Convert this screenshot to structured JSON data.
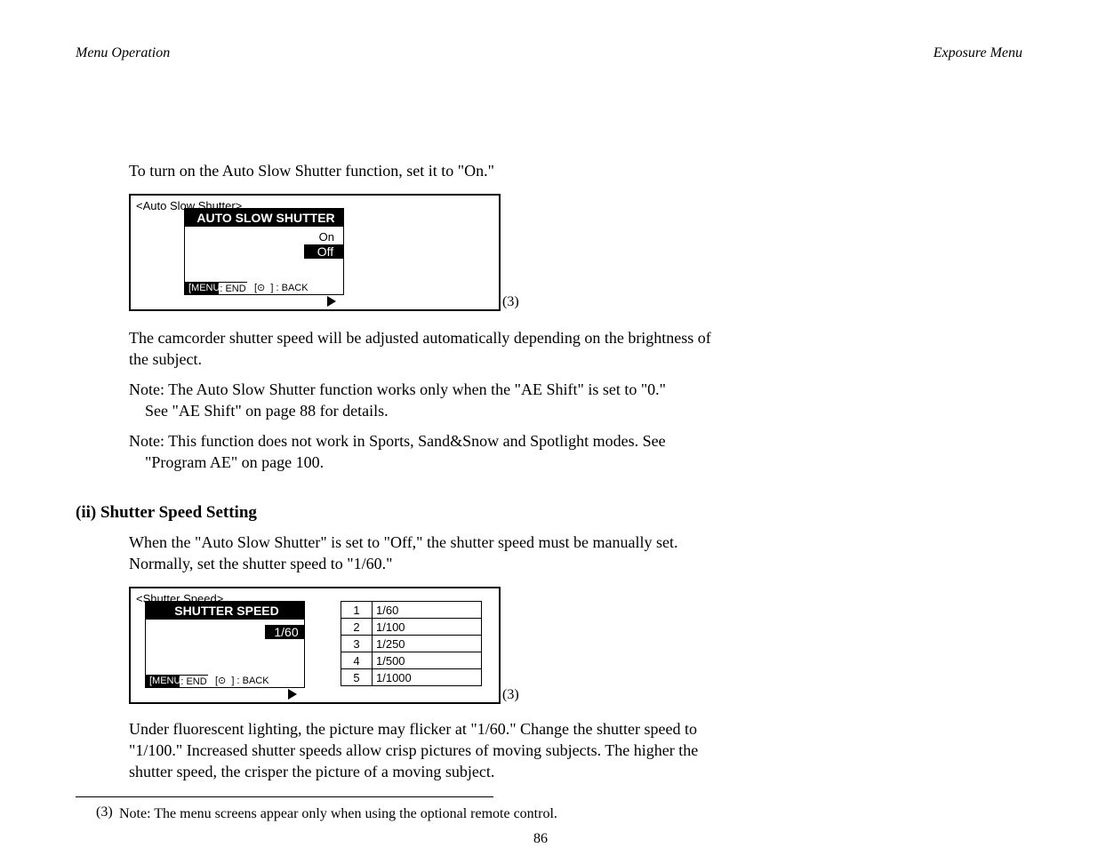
{
  "header": {
    "breadcrumb_left": "Menu Operation",
    "breadcrumb_right": "Exposure Menu",
    "page_number": "86"
  },
  "upper": {
    "paragraph": "To turn on the Auto Slow Shutter function, set it to \"On.\"",
    "fig1": {
      "outer_caption": "<Auto Slow Shutter>",
      "title": "AUTO SLOW SHUTTER",
      "menu": [
        "On",
        "Off"
      ],
      "hint1": "[MENU] : END",
      "hint2": "[⊙  ] : BACK"
    },
    "fig_label": "(3)",
    "after": [
      "The camcorder shutter speed will be adjusted automatically depending on the brightness of",
      "the subject.",
      "Note: The Auto Slow Shutter function works only when the \"AE Shift\" is set to \"0.\"",
      "    See \"AE Shift\" on page 88 for details.",
      "Note: This function does not work in Sports, Sand&Snow and Spotlight modes. See",
      "    \"Program AE\" on page 100."
    ]
  },
  "lower": {
    "heading": "(ii) Shutter Speed Setting",
    "intro": [
      "When the \"Auto Slow Shutter\" is set to \"Off,\" the shutter speed must be manually set.",
      "Normally, set the shutter speed to \"1/60.\""
    ],
    "fig2": {
      "outer_caption": "<Shutter Speed>",
      "title": "SHUTTER SPEED",
      "menu": [
        "1/60"
      ],
      "hint1": "[MENU] : END",
      "hint2": "[⊙  ] : BACK"
    },
    "fig2_label": "(3)",
    "table": [
      {
        "n": "1",
        "v": "1/60"
      },
      {
        "n": "2",
        "v": "1/100"
      },
      {
        "n": "3",
        "v": "1/250"
      },
      {
        "n": "4",
        "v": "1/500"
      },
      {
        "n": "5",
        "v": "1/1000"
      }
    ],
    "after": [
      "Under fluorescent lighting, the picture may flicker at \"1/60.\" Change the shutter speed to",
      "\"1/100.\" Increased shutter speeds allow crisp pictures of moving subjects. The higher the",
      "shutter speed, the crisper the picture of a moving subject."
    ]
  },
  "footnote": {
    "marker": "(3)",
    "text": "Note: The menu screens appear only when using the optional remote control."
  }
}
